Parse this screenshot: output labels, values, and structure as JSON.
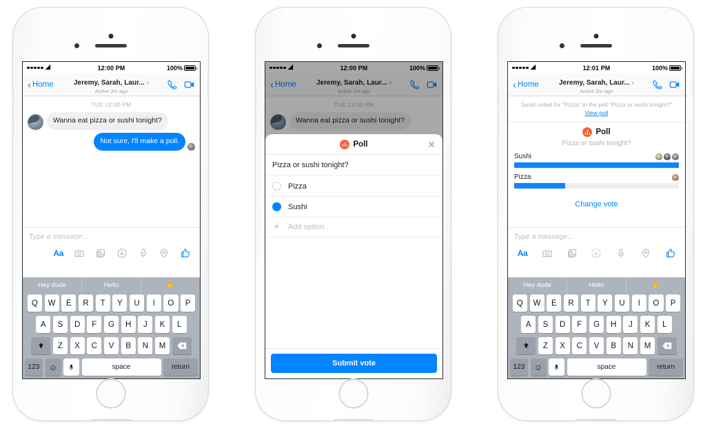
{
  "phones": [
    {
      "id": "phone-compose",
      "statusbar": {
        "time": "12:00 PM",
        "battery": "100%"
      },
      "navbar": {
        "back_label": "Home",
        "title": "Jeremy, Sarah, Laur...",
        "subtitle": "Active 2m ago",
        "call_icon": "phone-icon",
        "video_icon": "video-camera-icon"
      },
      "conversation": {
        "daystamp": "TUE 12:00 PM",
        "messages": [
          {
            "direction": "in",
            "text": "Wanna eat pizza or sushi tonight?"
          },
          {
            "direction": "out",
            "text": "Not sure, I'll make a poll."
          }
        ]
      },
      "composer": {
        "placeholder": "Type a message...",
        "icons": [
          "text-format-icon",
          "camera-icon",
          "photo-library-icon",
          "poll-icon",
          "microphone-icon",
          "location-icon",
          "thumbs-up-icon"
        ],
        "highlighted_icon": "poll-icon"
      },
      "keyboard": {
        "suggestions": [
          "Hey dude",
          "Hello",
          "✋"
        ],
        "row1": [
          "Q",
          "W",
          "E",
          "R",
          "T",
          "Y",
          "U",
          "I",
          "O",
          "P"
        ],
        "row2": [
          "A",
          "S",
          "D",
          "F",
          "G",
          "H",
          "J",
          "K",
          "L"
        ],
        "row3": [
          "Z",
          "X",
          "C",
          "V",
          "B",
          "N",
          "M"
        ],
        "shift": "⬆",
        "backspace": "⌫",
        "numeric": "123",
        "emoji": "☺",
        "mic": "mic-key-icon",
        "space": "space",
        "return": "return"
      }
    },
    {
      "id": "phone-poll-modal",
      "statusbar": {
        "time": "12:00 PM",
        "battery": "100%"
      },
      "navbar": {
        "back_label": "Home",
        "title": "Jeremy, Sarah, Laur...",
        "subtitle": "Active 2m ago"
      },
      "conversation": {
        "daystamp": "TUE 12:00 PM",
        "messages": [
          {
            "direction": "in",
            "text": "Wanna eat pizza or sushi tonight?"
          }
        ]
      },
      "modal": {
        "title": "Poll",
        "badge_icon": "poll-bars-icon",
        "close_icon": "close-icon",
        "question": "Pizza or sushi tonight?",
        "options": [
          {
            "label": "Pizza",
            "selected": false
          },
          {
            "label": "Sushi",
            "selected": true
          }
        ],
        "add_option_label": "Add option",
        "add_option_icon": "plus-icon",
        "submit_label": "Submit vote"
      }
    },
    {
      "id": "phone-poll-results",
      "statusbar": {
        "time": "12:01 PM",
        "battery": "100%"
      },
      "navbar": {
        "back_label": "Home",
        "title": "Jeremy, Sarah, Laur...",
        "subtitle": "Active 2m ago"
      },
      "system_message": {
        "text": "Sarah voted for \"Pizza\" in the poll \"Pizza or sushi tonight?\"",
        "link_label": "View poll"
      },
      "poll_card": {
        "title": "Poll",
        "question": "Pizza or sushi tonight?",
        "results": [
          {
            "label": "Sushi",
            "percent": 100,
            "voters": 3
          },
          {
            "label": "Pizza",
            "percent": 31,
            "voters": 1
          }
        ],
        "change_vote_label": "Change vote"
      },
      "composer": {
        "placeholder": "Type a message...",
        "icons": [
          "text-format-icon",
          "camera-icon",
          "photo-library-icon",
          "poll-icon",
          "microphone-icon",
          "location-icon",
          "thumbs-up-icon"
        ]
      },
      "keyboard": {
        "suggestions": [
          "Hey dude",
          "Hello",
          "✋"
        ],
        "row1": [
          "Q",
          "W",
          "E",
          "R",
          "T",
          "Y",
          "U",
          "I",
          "O",
          "P"
        ],
        "row2": [
          "A",
          "S",
          "D",
          "F",
          "G",
          "H",
          "J",
          "K",
          "L"
        ],
        "row3": [
          "Z",
          "X",
          "C",
          "V",
          "B",
          "N",
          "M"
        ],
        "shift": "⬆",
        "backspace": "⌫",
        "numeric": "123",
        "emoji": "☺",
        "space": "space",
        "return": "return"
      }
    }
  ],
  "colors": {
    "accent_blue": "#0084ff",
    "poll_orange": "#f0673c",
    "bubble_gray": "#f1f0f0",
    "keyboard_bg": "#aeb4bc"
  }
}
